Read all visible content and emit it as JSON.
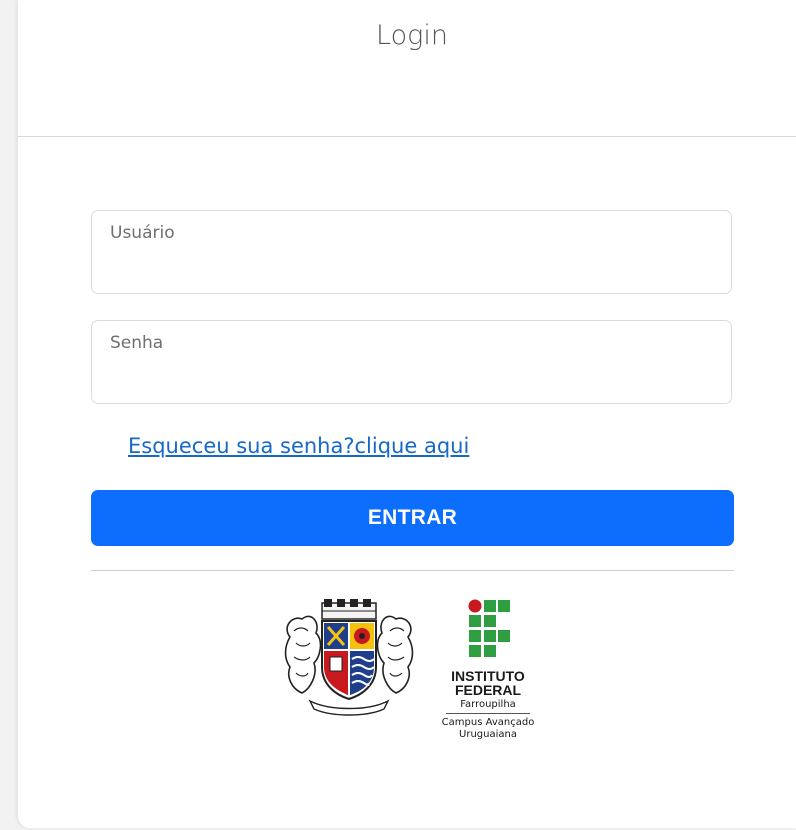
{
  "header": {
    "title": "Login"
  },
  "form": {
    "username_placeholder": "Usuário",
    "password_placeholder": "Senha",
    "forgot_link": "Esqueceu sua senha?clique aqui",
    "submit_label": "ENTRAR"
  },
  "logos": {
    "city_coat_of_arms": "city-coat-of-arms",
    "institute": {
      "line1": "INSTITUTO",
      "line2": "FEDERAL",
      "line3": "Farroupilha",
      "line4": "Campus Avançado",
      "line5": "Uruguaiana"
    }
  },
  "colors": {
    "primary": "#0d6efd",
    "link": "#1769c9",
    "if_green": "#2f9e41",
    "if_red": "#c8191e"
  }
}
